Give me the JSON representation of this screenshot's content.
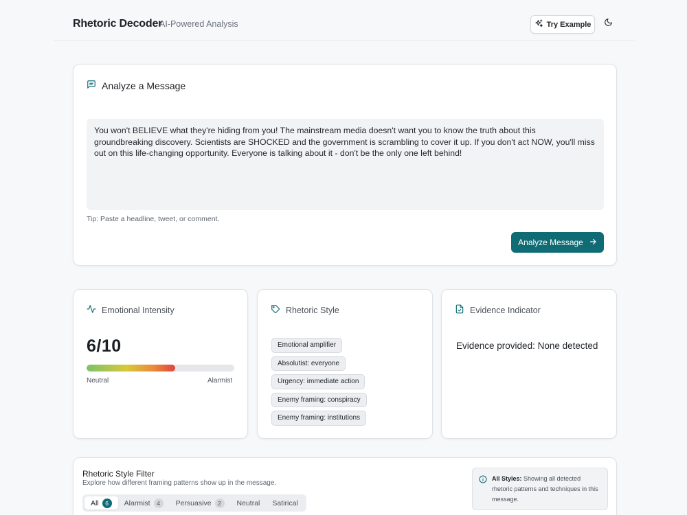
{
  "header": {
    "brand": "Rhetoric Decoder",
    "subtitle": "AI-Powered Analysis",
    "try_example_label": "Try Example",
    "icons": {
      "try_example": "sparkles-icon",
      "theme_toggle": "moon-icon"
    }
  },
  "analyze": {
    "title": "Analyze a Message",
    "icon": "message-square-icon",
    "message": "You won't BELIEVE what they're hiding from you! The mainstream media doesn't want you to know the truth about this groundbreaking discovery. Scientists are SHOCKED and the government is scrambling to cover it up. If you don't act NOW, you'll miss out on this life-changing opportunity. Everyone is talking about it - don't be the only one left behind!",
    "tip": "Tip: Paste a headline, tweet, or comment.",
    "button_label": "Analyze Message"
  },
  "emotional_intensity": {
    "title": "Emotional Intensity",
    "icon": "activity-icon",
    "score_text": "6/10",
    "score_fraction": 0.6,
    "scale_low": "Neutral",
    "scale_high": "Alarmist"
  },
  "rhetoric_style": {
    "title": "Rhetoric Style",
    "icon": "tag-icon",
    "tags": [
      "Emotional amplifier",
      "Absolutist: everyone",
      "Urgency: immediate action",
      "Enemy framing: conspiracy",
      "Enemy framing: institutions"
    ]
  },
  "evidence": {
    "title": "Evidence Indicator",
    "icon": "file-check-icon",
    "text": "Evidence provided: None detected"
  },
  "filter": {
    "title": "Rhetoric Style Filter",
    "subtitle": "Explore how different framing patterns show up in the message.",
    "tabs": [
      {
        "label": "All",
        "count": "6"
      },
      {
        "label": "Alarmist",
        "count": "4"
      },
      {
        "label": "Persuasive",
        "count": "2"
      },
      {
        "label": "Neutral",
        "count": ""
      },
      {
        "label": "Satirical",
        "count": ""
      }
    ],
    "info_bold": "All Styles:",
    "info_text": " Showing all detected rhetoric patterns and techniques in this message."
  },
  "colors": {
    "accent": "#0f6b74",
    "page_bg": "#f7f8f9",
    "gauge_start": "#7cc16a",
    "gauge_end": "#e0453f"
  }
}
